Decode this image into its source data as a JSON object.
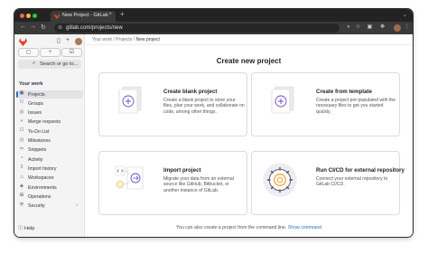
{
  "browser": {
    "tab_title": "New Project · GitLab",
    "tab_close": "×",
    "new_tab": "+",
    "url": "gitlab.com/projects/new"
  },
  "sidebar": {
    "search_text": "Search or go to...",
    "context_label": "Your work",
    "items": [
      {
        "label": "Projects",
        "icon": "▣",
        "active": true
      },
      {
        "label": "Groups",
        "icon": "⚇"
      },
      {
        "label": "Issues",
        "icon": "◎"
      },
      {
        "label": "Merge requests",
        "icon": "⑂"
      },
      {
        "label": "To-Do List",
        "icon": "☐"
      },
      {
        "label": "Milestones",
        "icon": "◷"
      },
      {
        "label": "Snippets",
        "icon": "✂"
      },
      {
        "label": "Activity",
        "icon": "◔"
      },
      {
        "label": "Import history",
        "icon": "⇪"
      },
      {
        "label": "Workspaces",
        "icon": "⌂"
      },
      {
        "label": "Environments",
        "icon": "◈"
      },
      {
        "label": "Operations",
        "icon": "⊞"
      },
      {
        "label": "Security",
        "icon": "⛨",
        "chevron": "›"
      }
    ],
    "help_label": "Help"
  },
  "breadcrumb": {
    "items": [
      "Your work",
      "Projects",
      "New project"
    ],
    "separator": "/"
  },
  "page": {
    "title": "Create new project"
  },
  "cards": [
    {
      "title": "Create blank project",
      "desc": "Create a blank project to store your files, plan your work, and collaborate on code, among other things."
    },
    {
      "title": "Create from template",
      "desc": "Create a project pre-populated with the necessary files to get you started quickly."
    },
    {
      "title": "Import project",
      "desc": "Migrate your data from an external source like GitHub, Bitbucket, or another instance of GitLab."
    },
    {
      "title": "Run CI/CD for external repository",
      "desc": "Connect your external repository to GitLab CI/CD."
    }
  ],
  "footer": {
    "text": "You can also create a project from the command line.",
    "link": "Show command"
  },
  "colors": {
    "accent": "#1f75cb",
    "brand": "#e24329",
    "illustration": "#6e49cb"
  }
}
